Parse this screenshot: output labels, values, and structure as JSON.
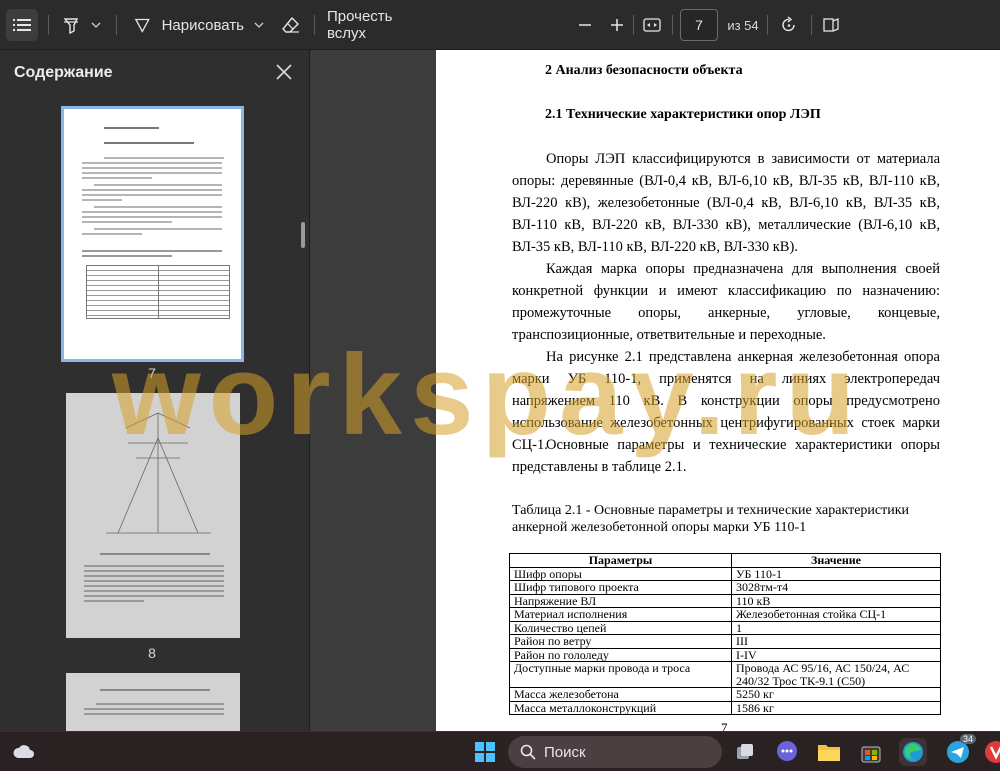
{
  "toolbar": {
    "draw_label": "Нарисовать",
    "read_aloud_label": "Прочесть вслух",
    "page_number": "7",
    "page_total": "из 54",
    "icons": [
      "contents-icon",
      "highlight-icon",
      "chevron-down-icon",
      "draw-icon",
      "eraser-icon",
      "zoom-out-icon",
      "zoom-in-icon",
      "fit-page-icon",
      "rotate-icon",
      "page-view-icon"
    ]
  },
  "sidebar": {
    "title": "Содержание",
    "thumbnails": [
      {
        "number": "7",
        "selected": true
      },
      {
        "number": "8",
        "selected": false
      }
    ]
  },
  "document": {
    "section_title": "2 Анализ безопасности объекта",
    "subsection_title": "2.1 Технические характеристики опор ЛЭП",
    "paragraphs": [
      "Опоры ЛЭП классифицируются в зависимости от материала опоры: деревянные (ВЛ-0,4 кВ, ВЛ-6,10 кВ, ВЛ-35 кВ, ВЛ-110 кВ, ВЛ-220 кВ), железобетонные (ВЛ-0,4 кВ, ВЛ-6,10 кВ, ВЛ-35 кВ, ВЛ-110 кВ, ВЛ-220 кВ, ВЛ-330 кВ), металлические (ВЛ-6,10 кВ, ВЛ-35 кВ, ВЛ-110 кВ, ВЛ-220 кВ, ВЛ-330 кВ).",
      "Каждая марка опоры предназначена для выполнения своей конкретной функции и имеют классификацию по назначению: промежуточные опоры, анкерные, угловые, концевые, транспозиционные, ответвительные и переходные.",
      "На рисунке 2.1 представлена анкерная железобетонная опора марки УБ 110-1, применятся на линиях электропередач напряжением 110 кВ. В конструкции опоры предусмотрено использование железобетонных центрифугированных стоек марки СЦ-1.",
      "Основные параметры и технические характеристики опоры представлены в таблице 2.1."
    ],
    "table_caption": "Таблица 2.1 - Основные параметры и технические характеристики анкерной железобетонной опоры марки УБ 110-1",
    "table_headers": [
      "Параметры",
      "Значение"
    ],
    "table_rows": [
      [
        "Шифр опоры",
        "УБ 110-1"
      ],
      [
        "Шифр типового проекта",
        "3028тм-т4"
      ],
      [
        "Напряжение ВЛ",
        "110 кВ"
      ],
      [
        "Материал исполнения",
        "Железобетонная стойка СЦ-1"
      ],
      [
        "Количество цепей",
        "1"
      ],
      [
        "Район по ветру",
        "III"
      ],
      [
        "Район по гололеду",
        "I-IV"
      ],
      [
        "Доступные марки провода и троса",
        "Провода АС 95/16, АС 150/24, АС 240/32 Трос ТК-9.1 (С50)"
      ],
      [
        "Масса железобетона",
        "5250 кг"
      ],
      [
        "Масса металлоконструкций",
        "1586 кг"
      ]
    ],
    "page_footer_number": "7"
  },
  "watermark": "workspay.ru",
  "taskbar": {
    "search_label": "Поиск",
    "icons": [
      "weather-icon",
      "windows-start-icon",
      "search-icon",
      "task-view-icon",
      "chat-icon",
      "file-explorer-icon",
      "store-icon",
      "edge-icon",
      "telegram-icon",
      "vivaldi-icon"
    ],
    "badge": "34"
  },
  "colors": {
    "toolbar_bg": "#2b2b2b",
    "sidebar_bg": "#2f2f2f",
    "viewer_bg": "#3c3c3c",
    "selection_outline": "#8ab6e8",
    "watermark": "#d6a028",
    "taskbar_bg": "#2a2122"
  }
}
